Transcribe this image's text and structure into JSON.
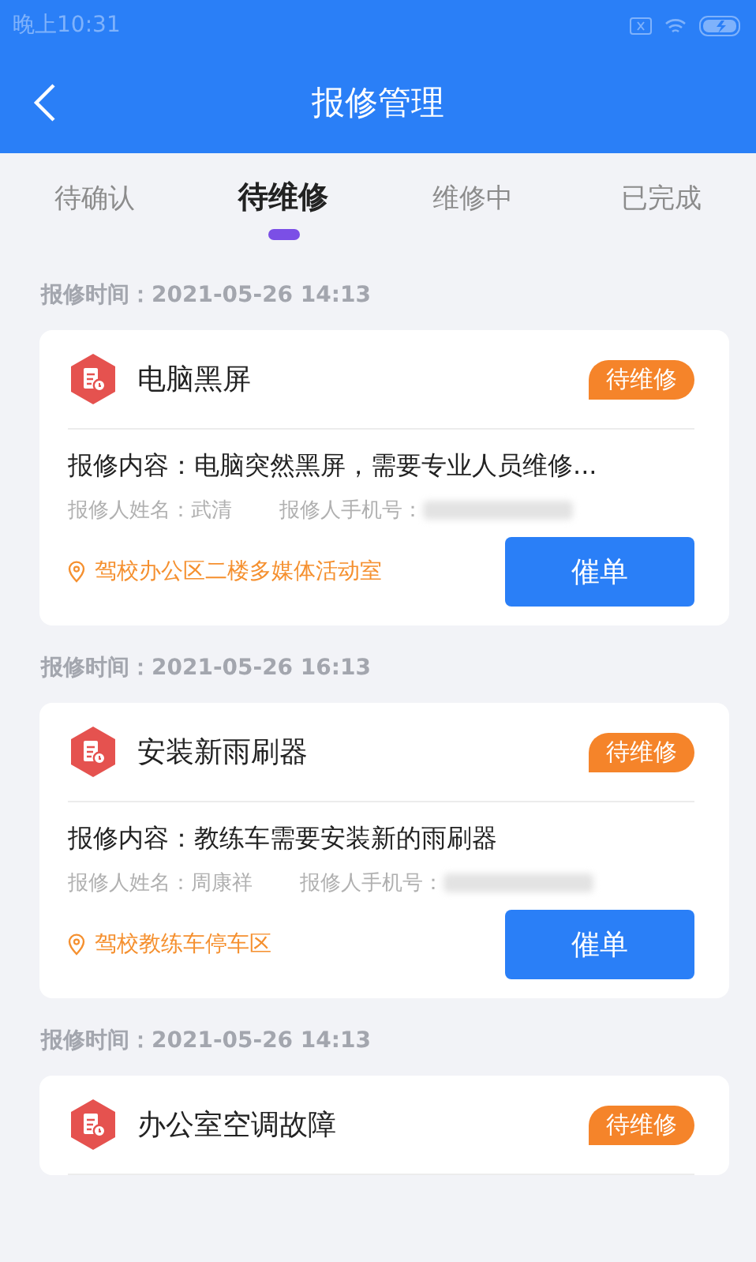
{
  "status_bar": {
    "time": "晚上10:31"
  },
  "header": {
    "title": "报修管理"
  },
  "tabs": [
    {
      "label": "待确认",
      "selected": false
    },
    {
      "label": "待维修",
      "selected": true
    },
    {
      "label": "维修中",
      "selected": false
    },
    {
      "label": "已完成",
      "selected": false
    }
  ],
  "orders": [
    {
      "time": "报修时间：2021-05-26 14:13",
      "title": "电脑黑屏",
      "status": "待维修",
      "content": "报修内容：电脑突然黑屏，需要专业人员维修...",
      "reporter": "报修人姓名：武清",
      "phone_label": "报修人手机号：",
      "location": "驾校办公区二楼多媒体活动室",
      "button": "催单"
    },
    {
      "time": "报修时间：2021-05-26 16:13",
      "title": "安装新雨刷器",
      "status": "待维修",
      "content": "报修内容：教练车需要安装新的雨刷器",
      "reporter": "报修人姓名：周康祥",
      "phone_label": "报修人手机号：",
      "location": "驾校教练车停车区",
      "button": "催单"
    },
    {
      "time": "报修时间：2021-05-26 14:13",
      "title": "办公室空调故障",
      "status": "待维修"
    }
  ]
}
